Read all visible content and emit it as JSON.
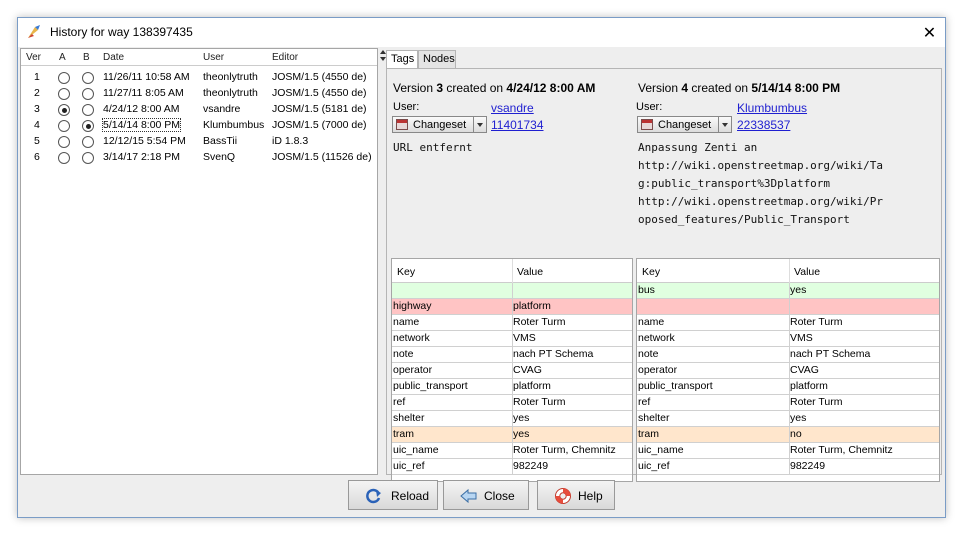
{
  "window": {
    "title": "History for way 138397435"
  },
  "history": {
    "columns": [
      "Ver",
      "A",
      "B",
      "Date",
      "User",
      "Editor"
    ],
    "rows": [
      {
        "ver": "1",
        "a": false,
        "b": false,
        "date": "11/26/11 10:58 AM",
        "user": "theonlytruth",
        "editor": "JOSM/1.5 (4550 de)"
      },
      {
        "ver": "2",
        "a": false,
        "b": false,
        "date": "11/27/11 8:05 AM",
        "user": "theonlytruth",
        "editor": "JOSM/1.5 (4550 de)"
      },
      {
        "ver": "3",
        "a": true,
        "b": false,
        "date": "4/24/12 8:00 AM",
        "user": "vsandre",
        "editor": "JOSM/1.5 (5181 de)"
      },
      {
        "ver": "4",
        "a": false,
        "b": true,
        "date": "5/14/14 8:00 PM",
        "user": "Klumbumbus",
        "editor": "JOSM/1.5 (7000 de)"
      },
      {
        "ver": "5",
        "a": false,
        "b": false,
        "date": "12/12/15 5:54 PM",
        "user": "BassTii",
        "editor": "iD 1.8.3"
      },
      {
        "ver": "6",
        "a": false,
        "b": false,
        "date": "3/14/17 2:18 PM",
        "user": "SvenQ",
        "editor": "JOSM/1.5 (11526 de)"
      }
    ]
  },
  "tabs": [
    "Tags",
    "Nodes"
  ],
  "left_version": {
    "title_prefix": "Version ",
    "number": "3",
    "created_on": " created on ",
    "date": "4/24/12 8:00 AM",
    "user_label": "User:",
    "user": "vsandre",
    "changeset_label": "Changeset",
    "changeset_id": "11401734",
    "comment": "URL entfernt"
  },
  "right_version": {
    "title_prefix": "Version ",
    "number": "4",
    "created_on": " created on ",
    "date": "5/14/14 8:00 PM",
    "user_label": "User:",
    "user": "Klumbumbus",
    "changeset_label": "Changeset",
    "changeset_id": "22338537",
    "comment": "Anpassung Zenti an\nhttp://wiki.openstreetmap.org/wiki/Ta\ng:public_transport%3Dplatform\nhttp://wiki.openstreetmap.org/wiki/Pr\noposed_features/Public_Transport"
  },
  "tag_table": {
    "key_header": "Key",
    "value_header": "Value",
    "left_rows": [
      {
        "key": "",
        "value": "",
        "status": "added"
      },
      {
        "key": "highway",
        "value": "platform",
        "status": "removed"
      },
      {
        "key": "name",
        "value": "Roter Turm",
        "status": "same"
      },
      {
        "key": "network",
        "value": "VMS",
        "status": "same"
      },
      {
        "key": "note",
        "value": "nach PT Schema",
        "status": "same"
      },
      {
        "key": "operator",
        "value": "CVAG",
        "status": "same"
      },
      {
        "key": "public_transport",
        "value": "platform",
        "status": "same"
      },
      {
        "key": "ref",
        "value": "Roter Turm",
        "status": "same"
      },
      {
        "key": "shelter",
        "value": "yes",
        "status": "same"
      },
      {
        "key": "tram",
        "value": "yes",
        "status": "changed"
      },
      {
        "key": "uic_name",
        "value": "Roter Turm, Chemnitz",
        "status": "same"
      },
      {
        "key": "uic_ref",
        "value": "982249",
        "status": "same"
      }
    ],
    "right_rows": [
      {
        "key": "bus",
        "value": "yes",
        "status": "added"
      },
      {
        "key": "",
        "value": "",
        "status": "removed"
      },
      {
        "key": "name",
        "value": "Roter Turm",
        "status": "same"
      },
      {
        "key": "network",
        "value": "VMS",
        "status": "same"
      },
      {
        "key": "note",
        "value": "nach PT Schema",
        "status": "same"
      },
      {
        "key": "operator",
        "value": "CVAG",
        "status": "same"
      },
      {
        "key": "public_transport",
        "value": "platform",
        "status": "same"
      },
      {
        "key": "ref",
        "value": "Roter Turm",
        "status": "same"
      },
      {
        "key": "shelter",
        "value": "yes",
        "status": "same"
      },
      {
        "key": "tram",
        "value": "no",
        "status": "changed"
      },
      {
        "key": "uic_name",
        "value": "Roter Turm, Chemnitz",
        "status": "same"
      },
      {
        "key": "uic_ref",
        "value": "982249",
        "status": "same"
      }
    ],
    "colors": {
      "added": "#e0ffe0",
      "removed": "#ffc4c4",
      "changed": "#ffe6cc",
      "same": "#ffffff"
    }
  },
  "buttons": {
    "reload": "Reload",
    "close": "Close",
    "help": "Help"
  },
  "icons": {
    "app": "josm-history-icon",
    "reload": "reload-icon",
    "close": "close-arrow-icon",
    "help": "lifebuoy-icon",
    "changeset": "changeset-icon"
  }
}
